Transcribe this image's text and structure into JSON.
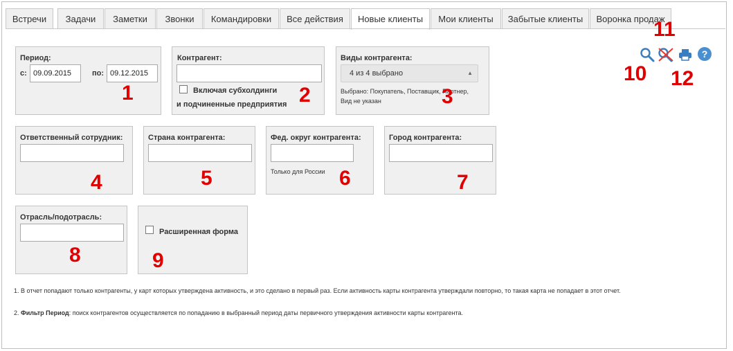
{
  "tabs": [
    "Встречи",
    "Задачи",
    "Заметки",
    "Звонки",
    "Командировки",
    "Все действия",
    "Новые клиенты",
    "Мои клиенты",
    "Забытые клиенты",
    "Воронка продаж"
  ],
  "active_tab": "Новые клиенты",
  "period": {
    "label": "Период:",
    "from_label": "с:",
    "from_value": "09.09.2015",
    "to_label": "по:",
    "to_value": "09.12.2015"
  },
  "counterparty": {
    "label": "Контрагент:",
    "value": "",
    "include_line1": "Включая субхолдинги",
    "include_line2": "и подчиненные предприятия"
  },
  "counterparty_types": {
    "label": "Виды контрагента:",
    "selected_text": "4 из 4 выбрано",
    "selected_line1": "Выбрано: Покупатель, Поставщик, Партнер,",
    "selected_line2": "Вид не указан"
  },
  "responsible": {
    "label": "Ответственный сотрудник:",
    "value": ""
  },
  "country": {
    "label": "Страна контрагента:",
    "value": ""
  },
  "federal_district": {
    "label": "Фед. округ контрагента:",
    "value": "",
    "hint": "Только для России"
  },
  "city": {
    "label": "Город контрагента:",
    "value": ""
  },
  "industry": {
    "label": "Отрасль/подотрасль:",
    "value": ""
  },
  "extended_form": {
    "label": "Расширенная форма"
  },
  "notes": {
    "n1": "1. В отчет попадают только контрагенты, у карт которых утверждена активность, и это сделано в первый раз. Если активность карты контрагента утверждали повторно, то такая карта не попадает в этот отчет.",
    "n2_prefix": "2. ",
    "n2_bold": "Фильтр Период",
    "n2_rest": ": поиск контрагентов осуществляется по попаданию в выбранный период даты первичного утверждения активности карты контрагента."
  },
  "annotations": [
    "1",
    "2",
    "3",
    "4",
    "5",
    "6",
    "7",
    "8",
    "9",
    "10",
    "11",
    "12"
  ],
  "icons": [
    "search-icon",
    "clear-filter-icon",
    "print-icon",
    "help-icon"
  ],
  "colors": {
    "annotation": "#e00000",
    "icon_blue": "#3a7ebf",
    "help_bg": "#4a8fd0",
    "clear_red": "#e53935"
  }
}
